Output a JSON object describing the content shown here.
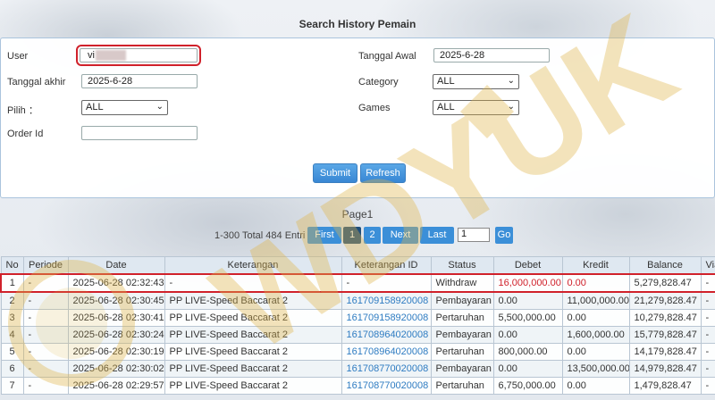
{
  "page": {
    "title": "Search History Pemain"
  },
  "form": {
    "user_label": "User",
    "user_value": "vi",
    "tanggal_awal_label": "Tanggal Awal",
    "tanggal_awal_value": "2025-6-28",
    "tanggal_akhir_label": "Tanggal akhir",
    "tanggal_akhir_value": "2025-6-28",
    "category_label": "Category",
    "category_value": "ALL",
    "pilih_label": "Pilih ：",
    "pilih_value": "ALL",
    "games_label": "Games",
    "games_value": "ALL",
    "order_id_label": "Order Id",
    "order_id_value": "",
    "submit_label": "Submit",
    "refresh_label": "Refresh"
  },
  "pager": {
    "title": "Page1",
    "total": "1-300 Total 484 Entri",
    "first": "First",
    "page1": "1",
    "page2": "2",
    "next": "Next",
    "last": "Last",
    "input_value": "1",
    "go": "Go"
  },
  "table": {
    "headers": [
      "No",
      "Periode",
      "Date",
      "Keterangan",
      "Keterangan ID",
      "Status",
      "Debet",
      "Kredit",
      "Balance",
      "Via"
    ],
    "rows": [
      {
        "no": "1",
        "periode": "-",
        "date": "2025-06-28 02:32:43",
        "keterangan": "-",
        "keterangan_id": "-",
        "status": "Withdraw",
        "debet": "16,000,000.00",
        "kredit": "0.00",
        "balance": "5,279,828.47",
        "via": "-"
      },
      {
        "no": "2",
        "periode": "-",
        "date": "2025-06-28 02:30:45",
        "keterangan": "PP LIVE-Speed Baccarat 2",
        "keterangan_id": "161709158920008",
        "status": "Pembayaran",
        "debet": "0.00",
        "kredit": "11,000,000.00",
        "balance": "21,279,828.47",
        "via": "-"
      },
      {
        "no": "3",
        "periode": "-",
        "date": "2025-06-28 02:30:41",
        "keterangan": "PP LIVE-Speed Baccarat 2",
        "keterangan_id": "161709158920008",
        "status": "Pertaruhan",
        "debet": "5,500,000.00",
        "kredit": "0.00",
        "balance": "10,279,828.47",
        "via": "-"
      },
      {
        "no": "4",
        "periode": "-",
        "date": "2025-06-28 02:30:24",
        "keterangan": "PP LIVE-Speed Baccarat 2",
        "keterangan_id": "161708964020008",
        "status": "Pembayaran",
        "debet": "0.00",
        "kredit": "1,600,000.00",
        "balance": "15,779,828.47",
        "via": "-"
      },
      {
        "no": "5",
        "periode": "-",
        "date": "2025-06-28 02:30:19",
        "keterangan": "PP LIVE-Speed Baccarat 2",
        "keterangan_id": "161708964020008",
        "status": "Pertaruhan",
        "debet": "800,000.00",
        "kredit": "0.00",
        "balance": "14,179,828.47",
        "via": "-"
      },
      {
        "no": "6",
        "periode": "-",
        "date": "2025-06-28 02:30:02",
        "keterangan": "PP LIVE-Speed Baccarat 2",
        "keterangan_id": "161708770020008",
        "status": "Pembayaran",
        "debet": "0.00",
        "kredit": "13,500,000.00",
        "balance": "14,979,828.47",
        "via": "-"
      },
      {
        "no": "7",
        "periode": "-",
        "date": "2025-06-28 02:29:57",
        "keterangan": "PP LIVE-Speed Baccarat 2",
        "keterangan_id": "161708770020008",
        "status": "Pertaruhan",
        "debet": "6,750,000.00",
        "kredit": "0.00",
        "balance": "1,479,828.47",
        "via": "-"
      }
    ]
  },
  "watermark": {
    "text": "WDYUK"
  },
  "colors": {
    "accent": "#3b8fd8",
    "active_page": "#1f4e7a",
    "highlight": "#d0212b",
    "link": "#2f7cc2",
    "watermark": "#e0b54a"
  }
}
